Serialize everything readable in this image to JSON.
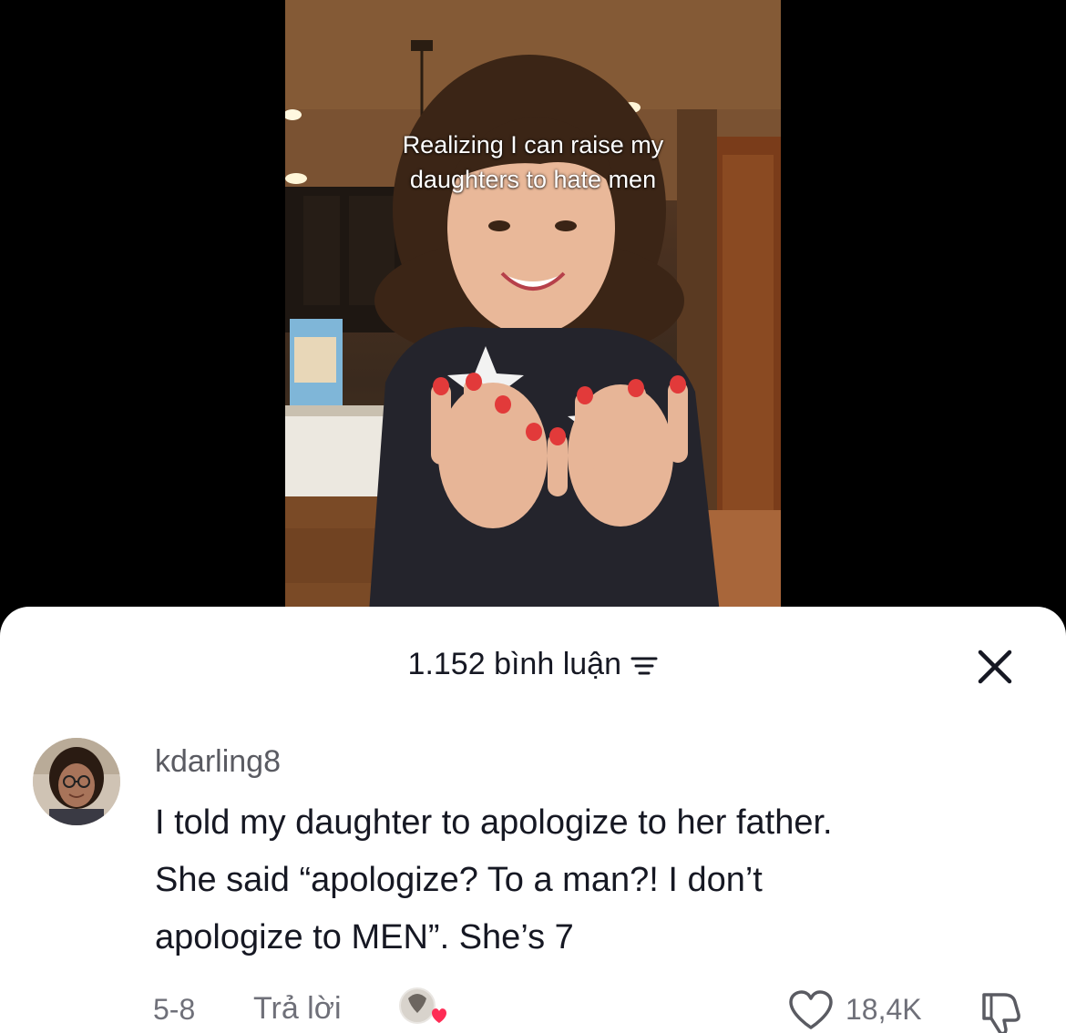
{
  "video": {
    "caption_lines": [
      "Realizing I can raise my",
      "daughters to hate men"
    ]
  },
  "comments_sheet": {
    "count_label": "1.152 bình luận",
    "sort_icon": "sort-filter-icon",
    "close_icon": "close-icon"
  },
  "comment": {
    "username": "kdarling8",
    "text_lines": [
      "I told my daughter to apologize to her father.",
      "She said “apologize? To a man?! I don’t",
      "apologize to MEN”. She’s 7"
    ],
    "date": "5-8",
    "reply_label": "Trả lời",
    "like_count": "18,4K",
    "creator_liked": true
  },
  "colors": {
    "sheet_bg": "#ffffff",
    "primary_text": "#161823",
    "secondary_text": "#6f7079",
    "heart_accent": "#fe2c55"
  }
}
